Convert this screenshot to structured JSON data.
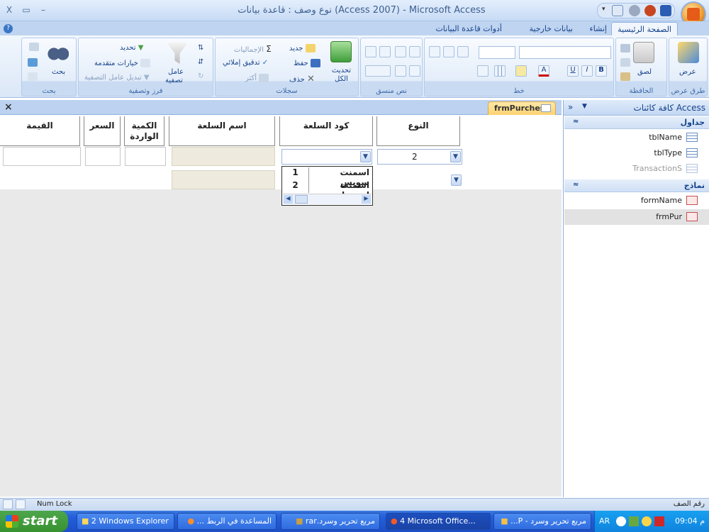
{
  "titlebar": {
    "title": "نوع وصف : قاعدة بيانات (Access 2007) - Microsoft Access",
    "close_glyph": "X",
    "restore_glyph": "▭",
    "minimize_glyph": "–"
  },
  "tabs": {
    "home": "الصفحة الرئيسية",
    "create": "إنشاء",
    "external": "بيانات خارجية",
    "dbtools": "أدوات قاعدة البيانات"
  },
  "ribbon": {
    "views": {
      "view": "عرض",
      "group": "طرق عرض"
    },
    "clipboard": {
      "paste": "لصق",
      "group": "الحافظة"
    },
    "font": {
      "group": "خط",
      "bold": "B",
      "italic": "I",
      "underline": "U",
      "font_color": "A"
    },
    "rich_text": {
      "group": "نص منسق"
    },
    "records": {
      "refresh": "تحديث",
      "refresh_all": "الكل",
      "new": "جديد",
      "save": "حفظ",
      "delete": "حذف",
      "totals": "الإجماليات",
      "spelling": "تدقيق إملائي",
      "more": "أكثر",
      "group": "سجلات"
    },
    "sort_filter": {
      "filter1": "عامل",
      "filter2": "تصفية",
      "selection": "تحديد",
      "advanced": "خيارات متقدمة",
      "toggle_filter": "تبديل عامل التصفية",
      "group": "فرز وتصفية"
    },
    "find": {
      "find": "بحث",
      "group": "بحث"
    }
  },
  "nav": {
    "header": "كافة كائنات Access",
    "collapse": "»",
    "sections": [
      {
        "title": "جداول",
        "items": [
          "tblName",
          "tblType",
          "TransactionS"
        ]
      },
      {
        "title": "نماذج",
        "items": [
          "formName",
          "frmPur"
        ]
      }
    ]
  },
  "form": {
    "tab_label": "frmPurches",
    "close_glyph": "×",
    "headers": {
      "type": "النوع",
      "item_code": "كود السلعة",
      "item_name": "اسم السلعة",
      "qty": "الكمية الواردة",
      "price": "السعر",
      "value": "القيمة"
    },
    "row1": {
      "type": "2"
    },
    "dropdown": {
      "items": [
        {
          "num": "1",
          "name": "اسمنت سويس"
        },
        {
          "num": "2",
          "name": "اسمنت اسيوط"
        }
      ]
    }
  },
  "status": {
    "num_lock": "Num Lock",
    "view_label": "رقم الصف"
  },
  "taskbar": {
    "start": "start",
    "buttons": [
      "2 Windows Explorer",
      "المساعدة في الربط ...",
      "مربع تحرير وسرد.rar",
      "4 Microsoft Office...",
      "مربع تحرير وسرد - P..."
    ],
    "lang": "AR",
    "time": "09:04 م"
  }
}
